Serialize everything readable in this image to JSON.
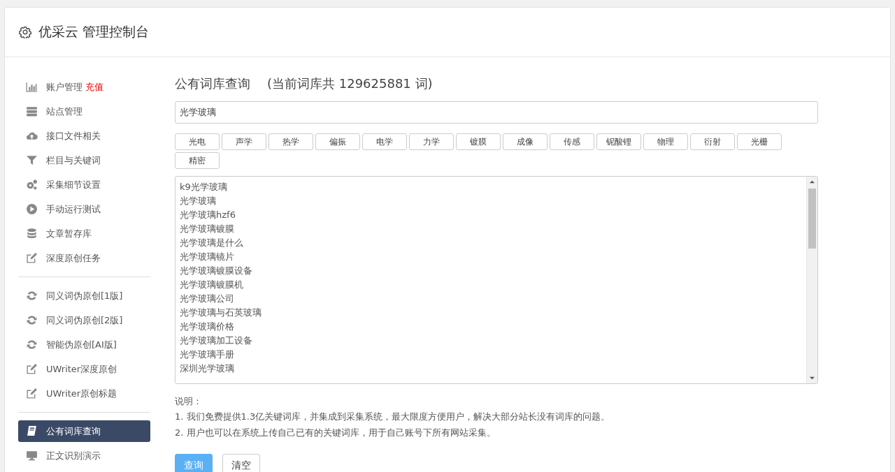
{
  "header": {
    "title": "优采云 管理控制台"
  },
  "sidebar": {
    "groups": [
      [
        {
          "label": "账户管理",
          "badge": "充值",
          "selected": false
        },
        {
          "label": "站点管理",
          "selected": false
        },
        {
          "label": "接口文件相关",
          "selected": false
        },
        {
          "label": "栏目与关键词",
          "selected": false
        },
        {
          "label": "采集细节设置",
          "selected": false
        },
        {
          "label": "手动运行测试",
          "selected": false
        },
        {
          "label": "文章暂存库",
          "selected": false
        },
        {
          "label": "深度原创任务",
          "selected": false
        }
      ],
      [
        {
          "label": "同义词伪原创[1版]",
          "selected": false
        },
        {
          "label": "同义词伪原创[2版]",
          "selected": false
        },
        {
          "label": "智能伪原创[AI版]",
          "selected": false
        },
        {
          "label": "UWriter深度原创",
          "selected": false
        },
        {
          "label": "UWriter原创标题",
          "selected": false
        }
      ],
      [
        {
          "label": "公有词库查询",
          "selected": true
        },
        {
          "label": "正文识别演示",
          "selected": false
        }
      ]
    ]
  },
  "main": {
    "title": "公有词库查询",
    "subtitle": "(当前词库共 129625881 词)",
    "search": {
      "value": "光学玻璃"
    },
    "tags": [
      "光电",
      "声学",
      "热学",
      "偏振",
      "电学",
      "力学",
      "镀膜",
      "成像",
      "传感",
      "铌酸锂",
      "物理",
      "衍射",
      "光栅",
      "精密"
    ],
    "results": [
      "k9光学玻璃",
      "光学玻璃",
      "光学玻璃hzf6",
      "光学玻璃镀膜",
      "光学玻璃是什么",
      "光学玻璃镜片",
      "光学玻璃镀膜设备",
      "光学玻璃镀膜机",
      "光学玻璃公司",
      "光学玻璃与石英玻璃",
      "光学玻璃价格",
      "光学玻璃加工设备",
      "光学玻璃手册",
      "深圳光学玻璃"
    ],
    "notes_title": "说明：",
    "notes": [
      "1. 我们免费提供1.3亿关键词库，并集成到采集系统，最大限度方便用户，解决大部分站长没有词库的问题。",
      "2. 用户也可以在系统上传自己已有的关键词库，用于自己账号下所有网站采集。"
    ],
    "buttons": [
      {
        "label": "查询",
        "kind": "primary"
      },
      {
        "label": "清空",
        "kind": "default"
      }
    ]
  }
}
